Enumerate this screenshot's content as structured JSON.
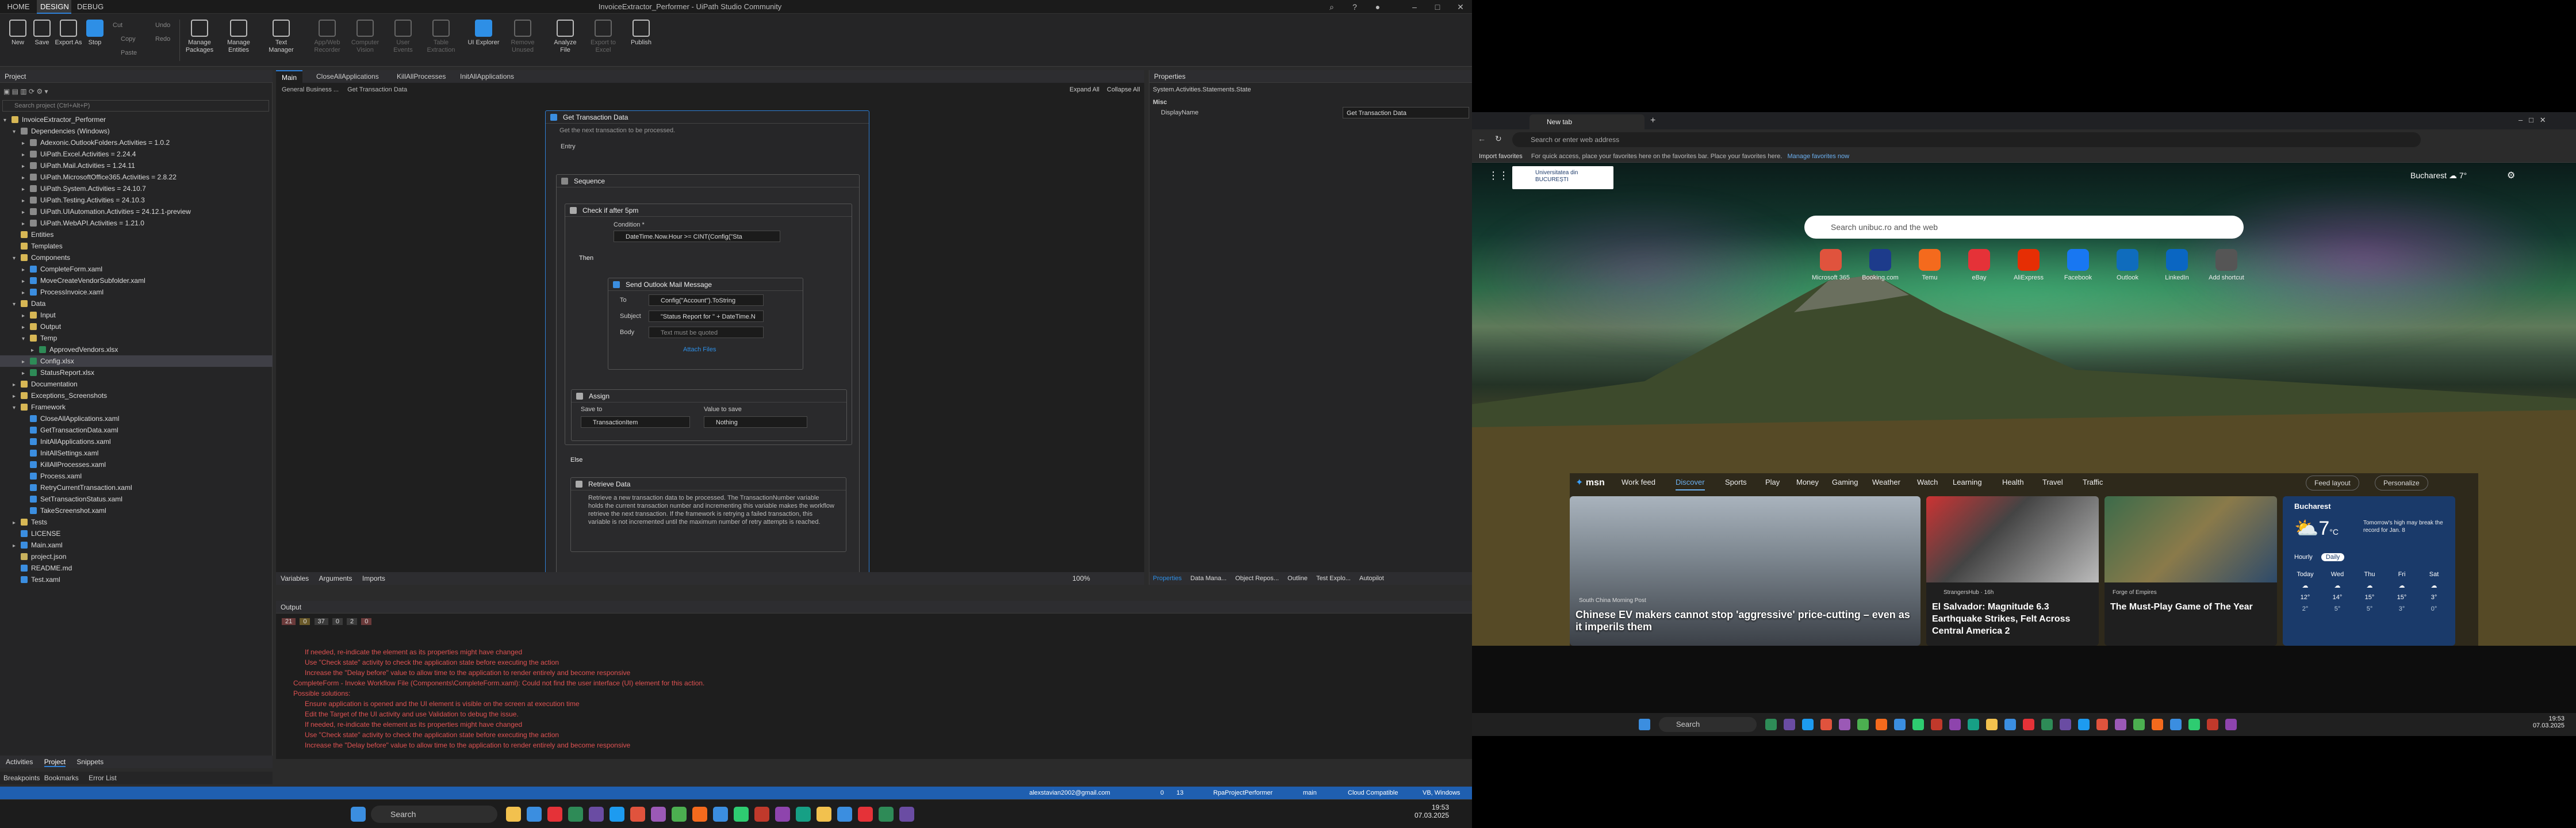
{
  "studio": {
    "title": "InvoiceExtractor_Performer - UiPath Studio Community",
    "menu_tabs": [
      "HOME",
      "DESIGN",
      "DEBUG"
    ],
    "ribbon": [
      "New",
      "Save",
      "Export As",
      "Stop",
      "Cut",
      "Undo",
      "Copy",
      "Redo",
      "Paste",
      "Manage Packages",
      "Manage Entities",
      "Text Manager",
      "App/Web Recorder",
      "Computer Vision",
      "User Events",
      "Table Extraction",
      "UI Explorer",
      "Remove Unused",
      "Analyze File",
      "Export to Excel",
      "Publish"
    ],
    "project_title": "Project",
    "search_placeholder": "Search project (Ctrl+Alt+P)",
    "tree": [
      {
        "t": "InvoiceExtractor_Performer",
        "d": 0,
        "k": "folder",
        "a": "▾"
      },
      {
        "t": "Dependencies (Windows)",
        "d": 1,
        "k": "pkg",
        "a": "▾"
      },
      {
        "t": "Adexonic.OutlookFolders.Activities = 1.0.2",
        "d": 2,
        "k": "pkg",
        "a": "▸"
      },
      {
        "t": "UiPath.Excel.Activities = 2.24.4",
        "d": 2,
        "k": "pkg",
        "a": "▸"
      },
      {
        "t": "UiPath.Mail.Activities = 1.24.11",
        "d": 2,
        "k": "pkg",
        "a": "▸"
      },
      {
        "t": "UiPath.MicrosoftOffice365.Activities = 2.8.22",
        "d": 2,
        "k": "pkg",
        "a": "▸"
      },
      {
        "t": "UiPath.System.Activities = 24.10.7",
        "d": 2,
        "k": "pkg",
        "a": "▸"
      },
      {
        "t": "UiPath.Testing.Activities = 24.10.3",
        "d": 2,
        "k": "pkg",
        "a": "▸"
      },
      {
        "t": "UiPath.UIAutomation.Activities = 24.12.1-preview",
        "d": 2,
        "k": "pkg",
        "a": "▸"
      },
      {
        "t": "UiPath.WebAPI.Activities = 1.21.0",
        "d": 2,
        "k": "pkg",
        "a": "▸"
      },
      {
        "t": "Entities",
        "d": 1,
        "k": "folder",
        "a": ""
      },
      {
        "t": "Templates",
        "d": 1,
        "k": "folder",
        "a": ""
      },
      {
        "t": "Components",
        "d": 1,
        "k": "folder",
        "a": "▾"
      },
      {
        "t": "CompleteForm.xaml",
        "d": 2,
        "k": "file",
        "a": "▸"
      },
      {
        "t": "MoveCreateVendorSubfolder.xaml",
        "d": 2,
        "k": "file",
        "a": "▸"
      },
      {
        "t": "ProcessInvoice.xaml",
        "d": 2,
        "k": "file",
        "a": "▸"
      },
      {
        "t": "Data",
        "d": 1,
        "k": "folder",
        "a": "▾"
      },
      {
        "t": "Input",
        "d": 2,
        "k": "folder",
        "a": "▸"
      },
      {
        "t": "Output",
        "d": 2,
        "k": "folder",
        "a": "▸"
      },
      {
        "t": "Temp",
        "d": 2,
        "k": "folder",
        "a": "▾"
      },
      {
        "t": "ApprovedVendors.xlsx",
        "d": 3,
        "k": "xl",
        "a": "▸"
      },
      {
        "t": "Config.xlsx",
        "d": 2,
        "k": "xl",
        "a": "▸"
      },
      {
        "t": "StatusReport.xlsx",
        "d": 2,
        "k": "xl",
        "a": "▸"
      },
      {
        "t": "Documentation",
        "d": 1,
        "k": "folder",
        "a": "▸"
      },
      {
        "t": "Exceptions_Screenshots",
        "d": 1,
        "k": "folder",
        "a": "▸"
      },
      {
        "t": "Framework",
        "d": 1,
        "k": "folder",
        "a": "▾"
      },
      {
        "t": "CloseAllApplications.xaml",
        "d": 2,
        "k": "file",
        "a": ""
      },
      {
        "t": "GetTransactionData.xaml",
        "d": 2,
        "k": "file",
        "a": ""
      },
      {
        "t": "InitAllApplications.xaml",
        "d": 2,
        "k": "file",
        "a": ""
      },
      {
        "t": "InitAllSettings.xaml",
        "d": 2,
        "k": "file",
        "a": ""
      },
      {
        "t": "KillAllProcesses.xaml",
        "d": 2,
        "k": "file",
        "a": ""
      },
      {
        "t": "Process.xaml",
        "d": 2,
        "k": "file",
        "a": ""
      },
      {
        "t": "RetryCurrentTransaction.xaml",
        "d": 2,
        "k": "file",
        "a": ""
      },
      {
        "t": "SetTransactionStatus.xaml",
        "d": 2,
        "k": "file",
        "a": ""
      },
      {
        "t": "TakeScreenshot.xaml",
        "d": 2,
        "k": "file",
        "a": ""
      },
      {
        "t": "Tests",
        "d": 1,
        "k": "folder",
        "a": "▸"
      },
      {
        "t": "LICENSE",
        "d": 1,
        "k": "file",
        "a": ""
      },
      {
        "t": "Main.xaml",
        "d": 1,
        "k": "file",
        "a": "▸"
      },
      {
        "t": "project.json",
        "d": 1,
        "k": "json",
        "a": ""
      },
      {
        "t": "README.md",
        "d": 1,
        "k": "file",
        "a": ""
      },
      {
        "t": "Test.xaml",
        "d": 1,
        "k": "file",
        "a": ""
      }
    ],
    "bottom_tabs": [
      "Activities",
      "Project",
      "Snippets"
    ],
    "bottom_tabs2": [
      "Breakpoints",
      "Bookmarks",
      "Error List"
    ],
    "doc_tabs": [
      "Main",
      "CloseAllApplications",
      "KillAllProcesses",
      "InitAllApplications"
    ],
    "breadcrumb": [
      "General Business ...",
      "Get Transaction Data"
    ],
    "expand_all": "Expand All",
    "collapse_all": "Collapse All",
    "wf": {
      "title": "Get Transaction Data",
      "subtitle": "Get the next transaction to be processed.",
      "entry": "Entry",
      "sequence": "Sequence",
      "check": "Check if after 5pm",
      "condition_lbl": "Condition *",
      "condition": "DateTime.Now.Hour >= CINT(Config(\"Sta",
      "then": "Then",
      "else": "Else",
      "send": "Send Outlook Mail Message",
      "to_lbl": "To",
      "to": "Config(\"Account\").ToString",
      "subj_lbl": "Subject",
      "subj": "\"Status Report for \" + DateTime.N",
      "body_lbl": "Body",
      "body": "Text must be quoted",
      "attach": "Attach Files",
      "assign": "Assign",
      "save_to": "Save to",
      "value_to_save": "Value to save",
      "assign_to": "TransactionItem",
      "assign_val": "Nothing",
      "retrieve": "Retrieve Data",
      "retrieve_text": "Retrieve a new transaction data to be processed. The TransactionNumber variable holds the current transaction number and incrementing this variable makes the workflow retrieve the next transaction. If the framework is retrying a failed transaction, this variable is not incremented until the maximum number of retry attempts is reached."
    },
    "designer_bottom": [
      "Variables",
      "Arguments",
      "Imports"
    ],
    "zoom": "100%",
    "props": {
      "title": "Properties",
      "type": "System.Activities.Statements.State",
      "section": "Misc",
      "key": "DisplayName",
      "value": "Get Transaction Data"
    },
    "panel_tabs": [
      "Properties",
      "Data Mana...",
      "Object Repos...",
      "Outline",
      "Test Explo...",
      "Autopilot"
    ],
    "output_title": "Output",
    "output_filters": [
      "21",
      "0",
      "37",
      "0",
      "2",
      "0"
    ],
    "output_lines": [
      "If needed, re-indicate the element as its properties might have changed",
      "Use \"Check state\" activity to check the application state before executing the action",
      "Increase the \"Delay before\" value to allow time to the application to render entirely and become responsive",
      "CompleteForm - Invoke Workflow File (Components\\CompleteForm.xaml): Could not find the user interface (UI) element for this action.",
      "Possible solutions:",
      "Ensure application is opened and the UI element is visible on the screen at execution time",
      "Edit the Target of the UI activity and use Validation to debug the issue.",
      "If needed, re-indicate the element as its properties might have changed",
      "Use \"Check state\" activity to check the application state before executing the action",
      "Increase the \"Delay before\" value to allow time to the application to render entirely and become responsive"
    ],
    "status": [
      "alexstavian2002@gmail.com",
      "0",
      "13",
      "RpaProjectPerformer",
      "main",
      "Cloud Compatible",
      "VB, Windows"
    ]
  },
  "taskbar_left": {
    "search": "Search",
    "time": "19:53",
    "date": "07.03.2025"
  },
  "browser": {
    "tab": "New tab",
    "address_placeholder": "Search or enter web address",
    "import": "Import favorites",
    "fav_msg": "For quick access, place your favorites here on the favorites bar. Place your favorites here.",
    "manage": "Manage favorites now",
    "logo": "Universitatea din BUCUREȘTI",
    "weather": "Bucharest",
    "temp": "7°",
    "search": "Search unibuc.ro and the web",
    "tiles": [
      "Microsoft 365",
      "Booking.com",
      "Temu",
      "eBay",
      "AliExpress",
      "Facebook",
      "Outlook",
      "LinkedIn",
      "Add shortcut"
    ],
    "msn": "msn",
    "feed_tabs": [
      "Work feed",
      "Discover",
      "Sports",
      "Play",
      "Money",
      "Gaming",
      "Weather",
      "Watch",
      "Learning",
      "Health",
      "Travel",
      "Traffic"
    ],
    "feed_layout": "Feed layout",
    "personalize": "Personalize",
    "news": [
      {
        "src": "South China Morning Post",
        "title": "Chinese EV makers cannot stop 'aggressive' price-cutting – even as it imperils them"
      },
      {
        "src": "StrangersHub · 16h",
        "title": "El Salvador: Magnitude 6.3 Earthquake Strikes, Felt Across Central America 2"
      },
      {
        "src": "Forge of Empires",
        "title": "The Must-Play Game of The Year"
      }
    ],
    "weather_card": {
      "city": "Bucharest",
      "temp": "7",
      "unit": "°C",
      "note": "Tomorrow's high may break the record for Jan. 8",
      "tabs": [
        "Hourly",
        "Daily"
      ],
      "days": [
        "Today",
        "Wed",
        "Thu",
        "Fri",
        "Sat"
      ],
      "highs": [
        "12°",
        "14°",
        "15°",
        "15°",
        "3°"
      ],
      "lows": [
        "2°",
        "5°",
        "5°",
        "3°",
        "0°"
      ]
    },
    "taskbar_search": "Search",
    "time": "19:53",
    "date": "07.03.2025"
  }
}
